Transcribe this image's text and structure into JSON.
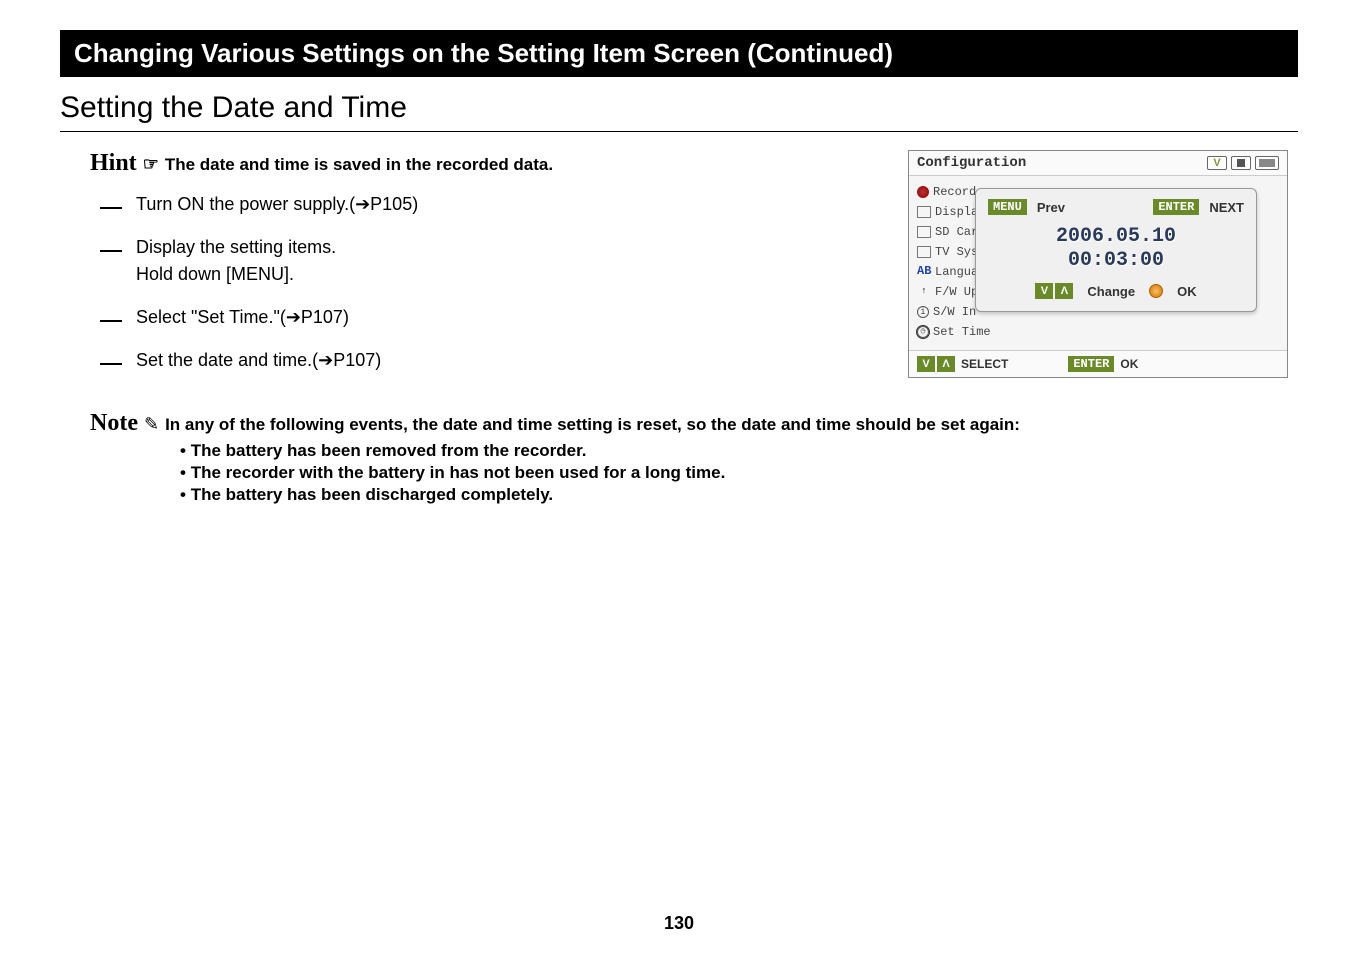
{
  "title": "Changing Various Settings on the Setting Item Screen (Continued)",
  "subtitle": "Setting the Date and Time",
  "hint": {
    "label": "Hint",
    "icon": "☞",
    "text": "The date and time is saved in the recorded data."
  },
  "steps": [
    "Turn ON the power supply.(➔P105)",
    "Display the setting items.\nHold down [MENU].",
    "Select \"Set Time.\"(➔P107)",
    "Set the date and time.(➔P107)"
  ],
  "note": {
    "label": "Note",
    "icon": "✎",
    "text": "In any of the following events, the date and time setting is reset, so the date and time should be set again:",
    "bullets": [
      "The battery has been removed from the recorder.",
      "The recorder with the battery in has not been used for a long time.",
      "The battery has been discharged completely."
    ]
  },
  "device": {
    "header_title": "Configuration",
    "side_items": [
      "Record",
      "Displa",
      "SD Car",
      "TV Sys",
      "Langua",
      "F/W Up",
      "S/W In",
      "Set Time"
    ],
    "popup": {
      "menu": "MENU",
      "prev": "Prev",
      "enter": "ENTER",
      "next": "NEXT",
      "date": "2006.05.10",
      "time": "00:03:00",
      "change": "Change",
      "ok": "OK"
    },
    "footer": {
      "select": "SELECT",
      "enter": "ENTER",
      "ok": "OK"
    }
  },
  "page_number": "130"
}
